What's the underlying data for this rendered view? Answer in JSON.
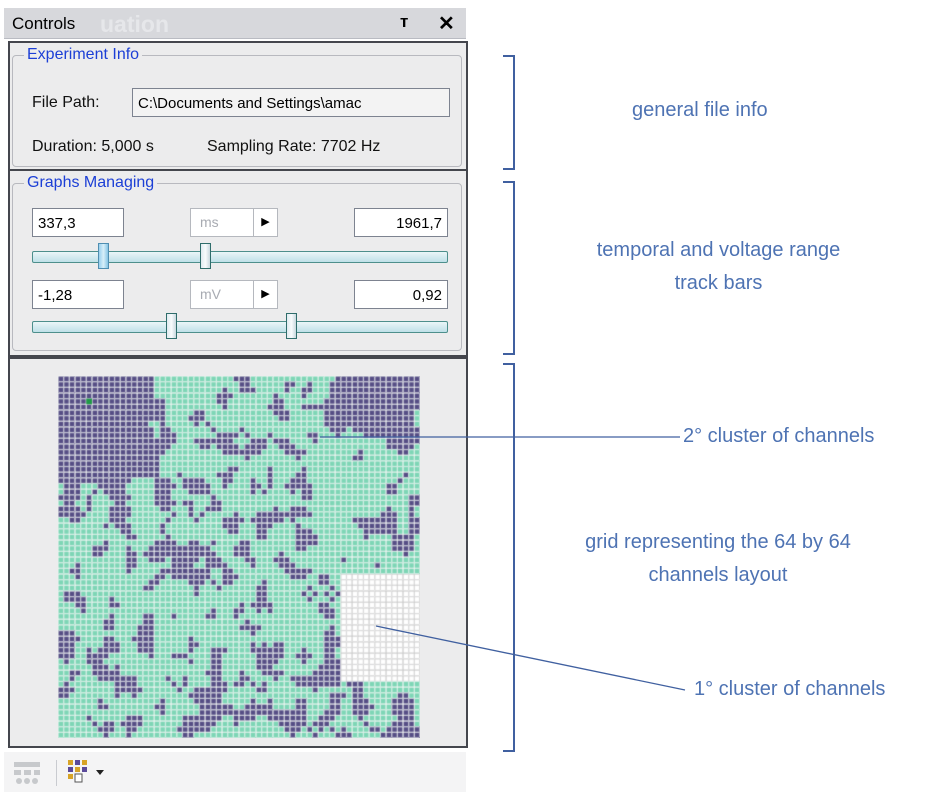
{
  "panel": {
    "title": "Controls",
    "ghost_title": "uation",
    "pin_icon": "т",
    "close_icon": "✕"
  },
  "experiment": {
    "legend": "Experiment Info",
    "file_path_label": "File Path:",
    "file_path_value": "C:\\Documents and Settings\\amac",
    "duration": "Duration: 5,000 s",
    "sampling_rate": "Sampling Rate: 7702 Hz"
  },
  "graphs": {
    "legend": "Graphs Managing",
    "time_min": "337,3",
    "time_unit": "ms",
    "time_max": "1961,7",
    "volt_min": "-1,28",
    "volt_unit": "mV",
    "volt_max": "0,92",
    "unit_arrow": "▶"
  },
  "annotations": {
    "general": "general file info",
    "track_line1": "temporal and voltage range",
    "track_line2": "track bars",
    "cluster2": "2°  cluster of channels",
    "grid_line1": "grid representing the 64 by 64",
    "grid_line2": "channels layout",
    "cluster1": "1°  cluster of channels"
  },
  "grid": {
    "rows": 64,
    "cols": 64,
    "colors": {
      "inactive": "#564e85",
      "active": "#7ed6b6",
      "cluster1": "#ffffff",
      "line": "#f2f6f4",
      "cluster1_line": "#c9c9c9",
      "marker": "#1f9a46"
    }
  },
  "colors": {
    "annotation": "#4e73b3",
    "legend": "#1c3fd6"
  }
}
